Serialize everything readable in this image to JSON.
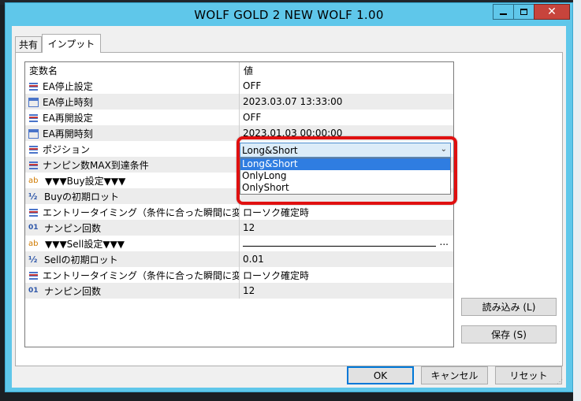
{
  "window": {
    "title": "WOLF GOLD 2 NEW WOLF 1.00",
    "close_label": "✕"
  },
  "tabs": [
    {
      "label": "共有"
    },
    {
      "label": "インプット"
    }
  ],
  "grid": {
    "headers": {
      "name": "変数名",
      "value": "値"
    },
    "rows": [
      {
        "icon": "list-icon",
        "name": "EA停止設定",
        "value": "OFF"
      },
      {
        "icon": "calendar-icon",
        "name": "EA停止時刻",
        "value": "2023.03.07 13:33:00"
      },
      {
        "icon": "list-icon",
        "name": "EA再開設定",
        "value": "OFF"
      },
      {
        "icon": "calendar-icon",
        "name": "EA再開時刻",
        "value": "2023.01.03 00:00:00"
      },
      {
        "icon": "list-icon",
        "name": "ポジション",
        "value": "Long&Short"
      },
      {
        "icon": "list-icon",
        "name": "ナンピン数MAX到達条件",
        "value": ""
      },
      {
        "icon": "string-icon",
        "name": "▼▼▼Buy設定▼▼▼",
        "value": ""
      },
      {
        "icon": "fraction-icon",
        "name": "Buyの初期ロット",
        "value": ""
      },
      {
        "icon": "list-icon",
        "name": "エントリータイミング（条件に合った瞬間に変更す...",
        "value": "ローソク確定時"
      },
      {
        "icon": "integer-icon",
        "name": "ナンピン回数",
        "value": "12"
      },
      {
        "icon": "string-icon",
        "name": "▼▼▼Sell設定▼▼▼",
        "value": "..."
      },
      {
        "icon": "fraction-icon",
        "name": "Sellの初期ロット",
        "value": "0.01"
      },
      {
        "icon": "list-icon",
        "name": "エントリータイミング（条件に合った瞬間に変更す...",
        "value": "ローソク確定時"
      },
      {
        "icon": "integer-icon",
        "name": "ナンピン回数",
        "value": "12"
      }
    ]
  },
  "position_select": {
    "selected": "Long&Short",
    "options": [
      "Long&Short",
      "OnlyLong",
      "OnlyShort"
    ]
  },
  "icon_glyphs": {
    "string": "ab",
    "fraction": "½",
    "integer": "01"
  },
  "buttons": {
    "load": "読み込み (L)",
    "save": "保存 (S)",
    "ok": "OK",
    "cancel": "キャンセル",
    "reset": "リセット"
  },
  "colors": {
    "titlebar": "#5fc7ea",
    "close_button": "#c7443c",
    "highlight_border": "#e01010",
    "selection": "#2f7de1"
  }
}
